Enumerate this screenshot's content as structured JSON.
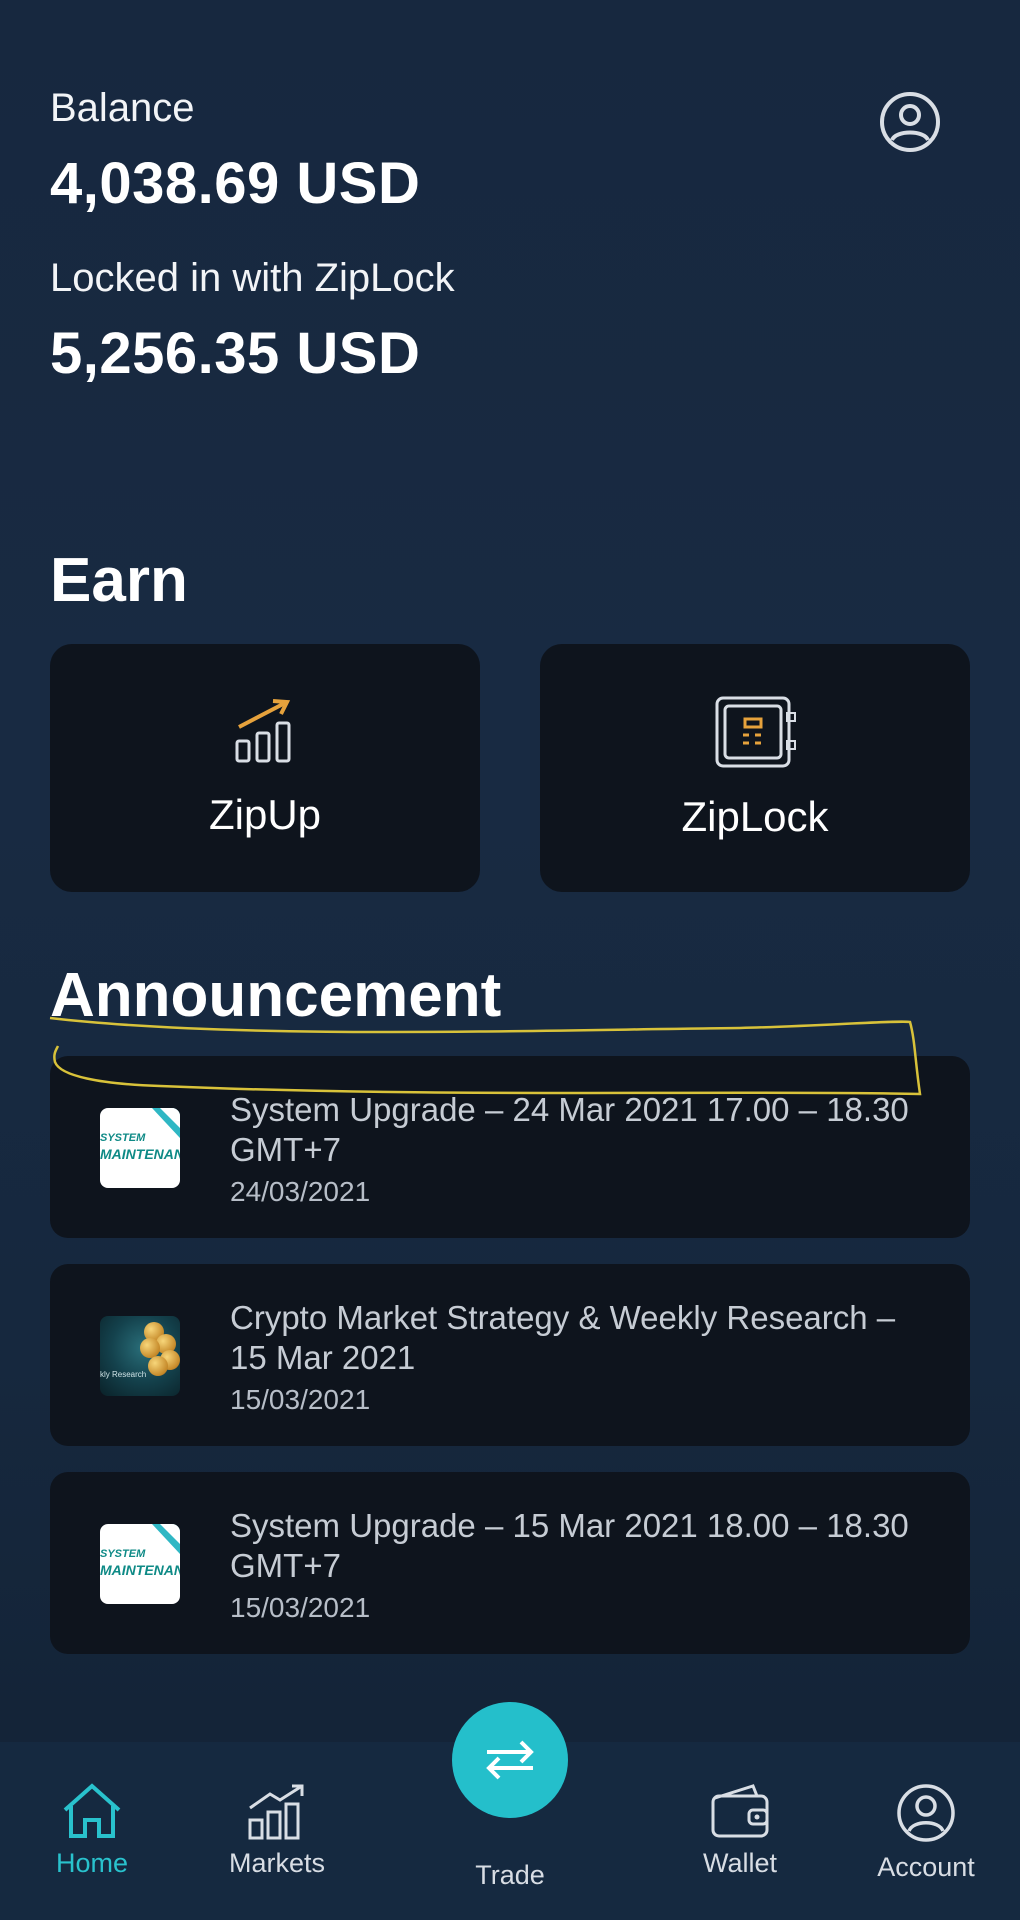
{
  "balance": {
    "label": "Balance",
    "value": "4,038.69 USD"
  },
  "locked": {
    "label": "Locked in with ZipLock",
    "value": "5,256.35 USD"
  },
  "earn": {
    "title": "Earn",
    "cards": [
      {
        "label": "ZipUp",
        "icon": "chart-growth-icon"
      },
      {
        "label": "ZipLock",
        "icon": "safe-icon"
      }
    ]
  },
  "announcement": {
    "title": "Announcement",
    "items": [
      {
        "title": "System Upgrade – 24 Mar 2021 17.00 – 18.30 GMT+7",
        "date": "24/03/2021",
        "thumb_line1": "SYSTEM",
        "thumb_line2": "MAINTENANCE"
      },
      {
        "title": "Crypto Market Strategy & Weekly Research – 15 Mar 2021",
        "date": "15/03/2021",
        "thumb_caption": "kly Research"
      },
      {
        "title": "System Upgrade – 15 Mar 2021 18.00 – 18.30 GMT+7",
        "date": "15/03/2021",
        "thumb_line1": "SYSTEM",
        "thumb_line2": "MAINTENANCE"
      }
    ]
  },
  "nav": {
    "home": "Home",
    "markets": "Markets",
    "trade": "Trade",
    "wallet": "Wallet",
    "account": "Account"
  },
  "colors": {
    "accent": "#29c2cd",
    "card": "#0e141d",
    "highlight": "#d8c23a"
  }
}
